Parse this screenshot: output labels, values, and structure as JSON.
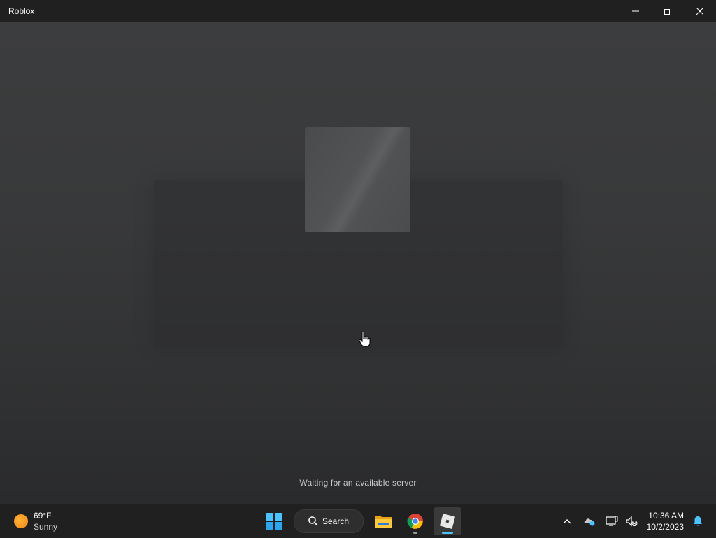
{
  "window": {
    "title": "Roblox"
  },
  "app": {
    "status_text": "Waiting for an available server"
  },
  "taskbar": {
    "weather": {
      "temperature": "69°F",
      "condition": "Sunny"
    },
    "search_label": "Search",
    "apps": [
      {
        "name": "Start",
        "icon": "windows-logo-icon"
      },
      {
        "name": "Search",
        "icon": "search-icon"
      },
      {
        "name": "File Explorer",
        "icon": "folder-icon"
      },
      {
        "name": "Google Chrome",
        "icon": "chrome-icon",
        "running": true
      },
      {
        "name": "Roblox",
        "icon": "roblox-icon",
        "running": true,
        "focused": true
      }
    ],
    "clock": {
      "time": "10:36 AM",
      "date": "10/2/2023"
    }
  },
  "colors": {
    "titlebar": "#202020",
    "taskbar": "#202020",
    "accent": "#4cc2ff",
    "status_text": "#c9cacb"
  }
}
